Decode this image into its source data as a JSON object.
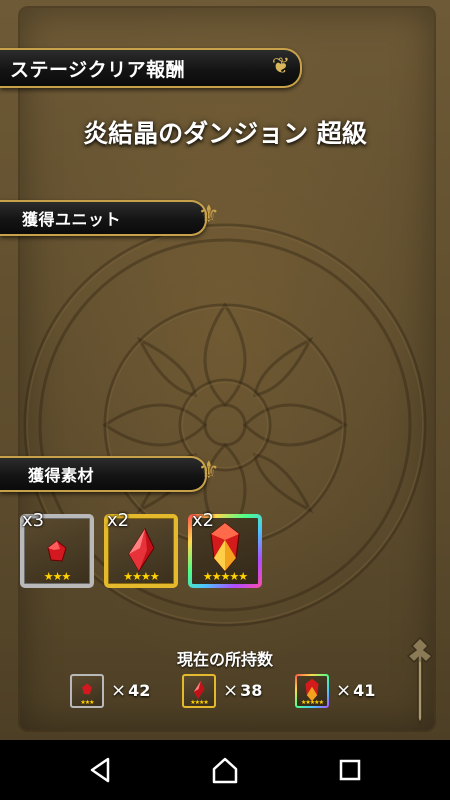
{
  "header": {
    "reward_title": "ステージクリア報酬",
    "stage_name": "炎結晶のダンジョン 超級"
  },
  "sections": {
    "units_title": "獲得ユニット",
    "materials_title": "獲得素材"
  },
  "materials": [
    {
      "count": "x3",
      "stars": "★★★",
      "rarity": "silver",
      "icon": "small-fire-crystal-icon"
    },
    {
      "count": "x2",
      "stars": "★★★★",
      "rarity": "gold",
      "icon": "fire-crystal-icon"
    },
    {
      "count": "x2",
      "stars": "★★★★★",
      "rarity": "rainbow",
      "icon": "large-fire-crystal-icon"
    }
  ],
  "owned": {
    "title": "現在の所持数",
    "items": [
      {
        "times": "×",
        "value": "42",
        "stars": "★★★"
      },
      {
        "times": "×",
        "value": "38",
        "stars": "★★★★"
      },
      {
        "times": "×",
        "value": "41",
        "stars": "★★★★★"
      }
    ]
  },
  "navigation": {
    "back": "back-icon",
    "home": "home-icon",
    "recents": "recents-icon"
  },
  "colors": {
    "banner_gold": "#c7a24a",
    "star_yellow": "#ffd400",
    "background_brown": "#62502f"
  }
}
